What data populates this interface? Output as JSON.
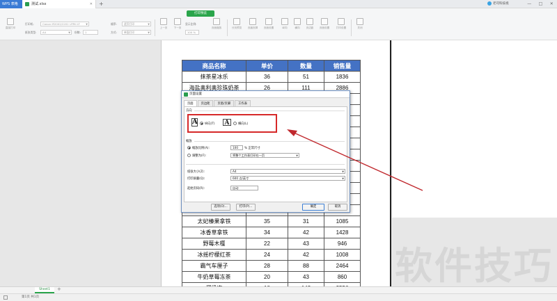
{
  "titlebar": {
    "app_tab": "WPS 表格",
    "file_tab": "测试.xlsx",
    "add_tab": "+",
    "user": "老司科技视",
    "window_buttons": [
      "—",
      "□",
      "✕"
    ]
  },
  "toolbar": {
    "mode_label": "打印预览",
    "direct_print": "直接打印",
    "printer_label": "打印机:",
    "printer_value": "Canon iR2002/2202 UFRII LT",
    "paper_type_label": "纸张类型:",
    "paper_type_value": "A4",
    "copies_label": "份数:",
    "copies_value": "1",
    "order_label": "顺序:",
    "order_value": "逐页打印",
    "mode2_label": "方式:",
    "mode2_value": "单面打印",
    "prev_page": "上一页",
    "next_page": "下一页",
    "zoom_label": "显示比例:",
    "zoom_value": "100 %",
    "page_zoom": "页面缩放",
    "right_buttons": [
      "分页预览",
      "页眉页脚",
      "页面设置",
      "纵向",
      "横向",
      "页边距",
      "页面设置",
      "打印设置",
      "关闭"
    ]
  },
  "sheet": {
    "headers": [
      "商品名称",
      "单价",
      "数量",
      "销售量"
    ],
    "rows": [
      [
        "抹茶星冰乐",
        "36",
        "51",
        "1836"
      ],
      [
        "海盐奥利奥珍珠奶茶",
        "26",
        "111",
        "2886"
      ],
      [
        "桃",
        "",
        "",
        ""
      ],
      [
        "柠",
        "",
        "",
        ""
      ],
      [
        "雪顶",
        "",
        "",
        ""
      ],
      [
        "",
        "",
        "",
        ""
      ],
      [
        "奶茶",
        "",
        "",
        ""
      ],
      [
        "鲜百",
        "",
        "",
        ""
      ],
      [
        "",
        "",
        "",
        ""
      ],
      [
        "黑",
        "",
        "",
        ""
      ],
      [
        "芝士",
        "",
        "",
        ""
      ],
      [
        "",
        "",
        "",
        ""
      ],
      [
        "柠",
        "",
        "",
        ""
      ],
      [
        "太妃榛果拿铁",
        "35",
        "31",
        "1085"
      ],
      [
        "冰香草拿铁",
        "34",
        "42",
        "1428"
      ],
      [
        "野莓木槿",
        "22",
        "43",
        "946"
      ],
      [
        "冰摇柠檬红茶",
        "24",
        "42",
        "1008"
      ],
      [
        "霸气车厘子",
        "28",
        "88",
        "2464"
      ],
      [
        "牛奶草莓冻茶",
        "20",
        "43",
        "860"
      ],
      [
        "椰奶冻",
        "18",
        "142",
        "2556"
      ]
    ]
  },
  "dialog": {
    "title": "页面设置",
    "tabs": [
      "页面",
      "页边距",
      "页眉/页脚",
      "工作表"
    ],
    "active_tab": "页面",
    "orientation_title": "方向",
    "portrait_label": "纵向(T)",
    "landscape_label": "横向(L)",
    "portrait_selected": true,
    "scaling_title": "缩放",
    "adjust_label": "缩放比例(A):",
    "adjust_value": "100",
    "adjust_suffix": "% 正常尺寸",
    "fit_label": "调整为(F):",
    "fit_value": "将整个工作表打印在一页",
    "paper_size_label": "纸张大小(Z):",
    "paper_size_value": "A4",
    "print_quality_label": "打印质量(Q):",
    "print_quality_value": "600 点/英寸",
    "first_page_label": "起始页码(R):",
    "first_page_value": "自动",
    "options_btn": "选项(O)...",
    "print_btn": "打印(P)...",
    "ok_btn": "确定",
    "cancel_btn": "取消",
    "highlight_color": "#d62828"
  },
  "watermark": "软件技巧",
  "sheetbar": {
    "sheet_name": "Sheet1",
    "add": "+"
  },
  "status": {
    "page_text": "第1页 共1页"
  }
}
